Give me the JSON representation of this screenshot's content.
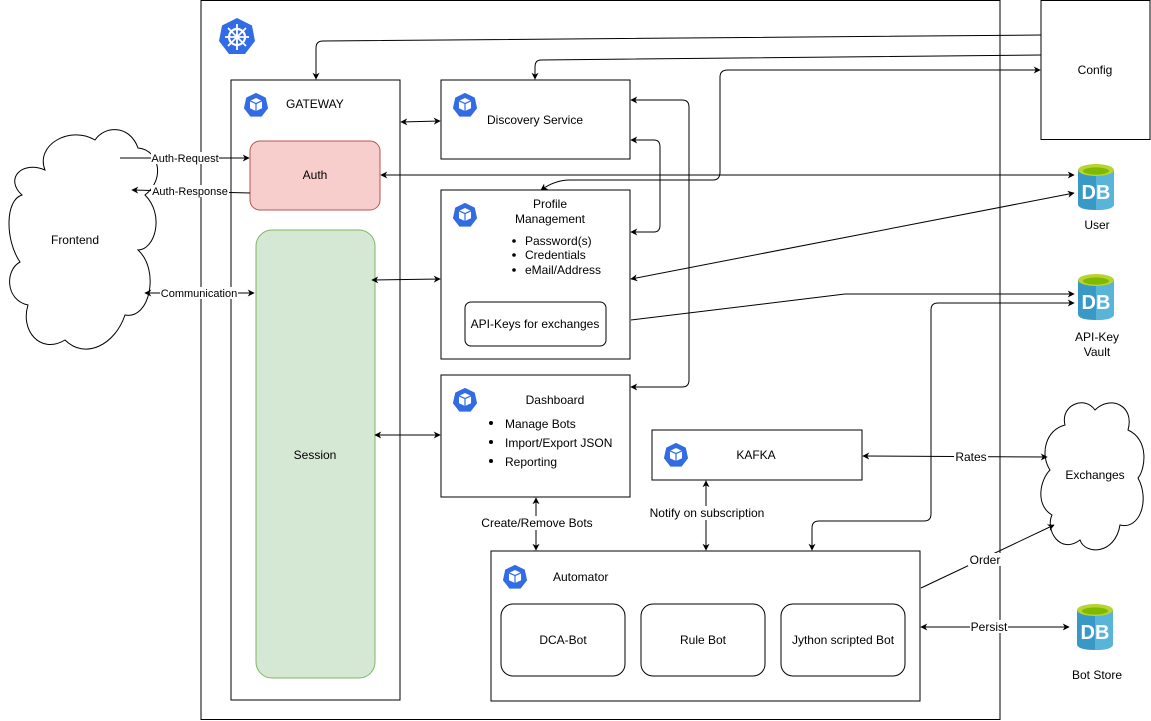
{
  "cluster": {
    "icon": "kubernetes-helm-icon",
    "accent": "#326ce5"
  },
  "nodes": {
    "frontend": {
      "label": "Frontend",
      "shape": "cloud"
    },
    "gateway": {
      "label": "GATEWAY",
      "icon": "k8s-pod-icon"
    },
    "auth": {
      "label": "Auth",
      "fill": "#f8cecc",
      "stroke": "#b85450"
    },
    "session": {
      "label": "Session",
      "fill": "#d5e8d4",
      "stroke": "#82b366"
    },
    "discovery": {
      "label": "Discovery Service",
      "icon": "k8s-pod-icon"
    },
    "profile": {
      "label_line1": "Profile",
      "label_line2": "Management",
      "icon": "k8s-pod-icon",
      "bullets": [
        "Password(s)",
        "Credentials",
        "eMail/Address"
      ],
      "inner_box": "API-Keys for exchanges"
    },
    "dashboard": {
      "label": "Dashboard",
      "icon": "k8s-pod-icon",
      "bullets": [
        "Manage Bots",
        "Import/Export JSON",
        "Reporting"
      ]
    },
    "kafka": {
      "label": "KAFKA",
      "icon": "k8s-pod-icon"
    },
    "automator": {
      "label": "Automator",
      "icon": "k8s-pod-icon",
      "bots": [
        "DCA-Bot",
        "Rule Bot",
        "Jython scripted Bot"
      ]
    },
    "config": {
      "label": "Config"
    },
    "db_user": {
      "label": "User",
      "icon": "database-icon",
      "text": "DB"
    },
    "db_vault": {
      "label_line1": "API-Key",
      "label_line2": "Vault",
      "icon": "database-icon",
      "text": "DB"
    },
    "exchanges": {
      "label": "Exchanges",
      "shape": "cloud"
    },
    "db_botstore": {
      "label": "Bot Store",
      "icon": "database-icon",
      "text": "DB"
    }
  },
  "edges": {
    "auth_request": "Auth-Request",
    "auth_response": "Auth-Response",
    "communication": "Communication",
    "create_remove": "Create/Remove Bots",
    "notify": "Notify on subscription",
    "rates": "Rates",
    "order": "Order",
    "persist": "Persist"
  },
  "colors": {
    "k8s_blue": "#326ce5",
    "db_blue": "#3999c6",
    "db_light": "#59b4d9",
    "db_top": "#7fba00"
  }
}
